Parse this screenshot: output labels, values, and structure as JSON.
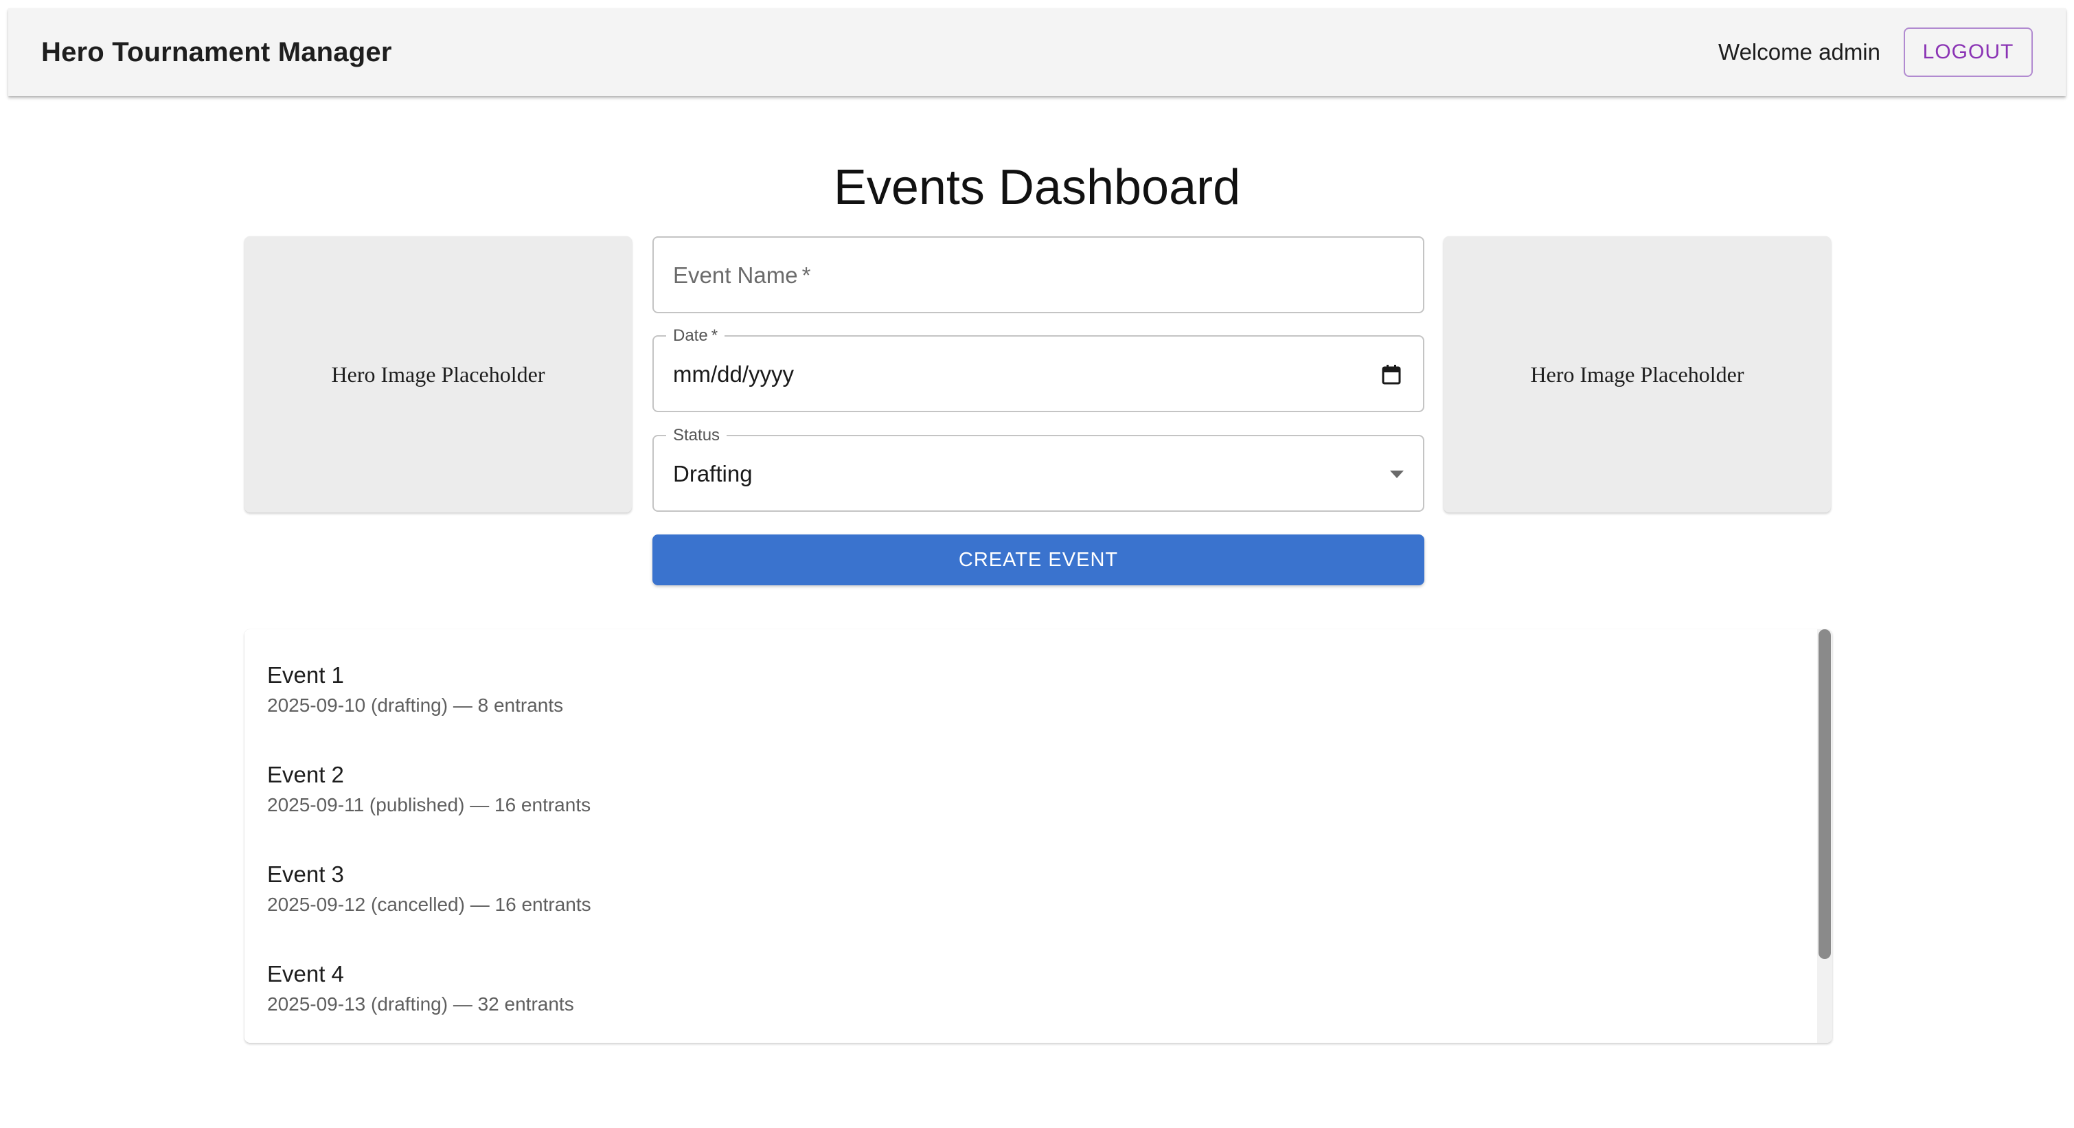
{
  "appbar": {
    "title": "Hero Tournament Manager",
    "welcome_text": "Welcome admin",
    "logout_label": "LOGOUT"
  },
  "page": {
    "title": "Events Dashboard"
  },
  "hero": {
    "left_text": "Hero Image Placeholder",
    "right_text": "Hero Image Placeholder"
  },
  "form": {
    "event_name": {
      "label": "Event Name",
      "required_mark": "*",
      "value": ""
    },
    "date": {
      "label": "Date",
      "required_mark": "*",
      "value": "mm/dd/yyyy"
    },
    "status": {
      "label": "Status",
      "value": "Drafting"
    },
    "submit_label": "CREATE EVENT"
  },
  "events": [
    {
      "title": "Event 1",
      "meta": "2025-09-10 (drafting) — 8 entrants"
    },
    {
      "title": "Event 2",
      "meta": "2025-09-11 (published) — 16 entrants"
    },
    {
      "title": "Event 3",
      "meta": "2025-09-12 (cancelled) — 16 entrants"
    },
    {
      "title": "Event 4",
      "meta": "2025-09-13 (drafting) — 32 entrants"
    }
  ],
  "colors": {
    "primary": "#3a73ce",
    "logout_accent": "#8a33b4",
    "appbar_bg": "#f4f4f4",
    "hero_bg": "#ececec"
  },
  "icons": {
    "date_field": "calendar-icon",
    "status_field": "dropdown-arrow-icon"
  }
}
